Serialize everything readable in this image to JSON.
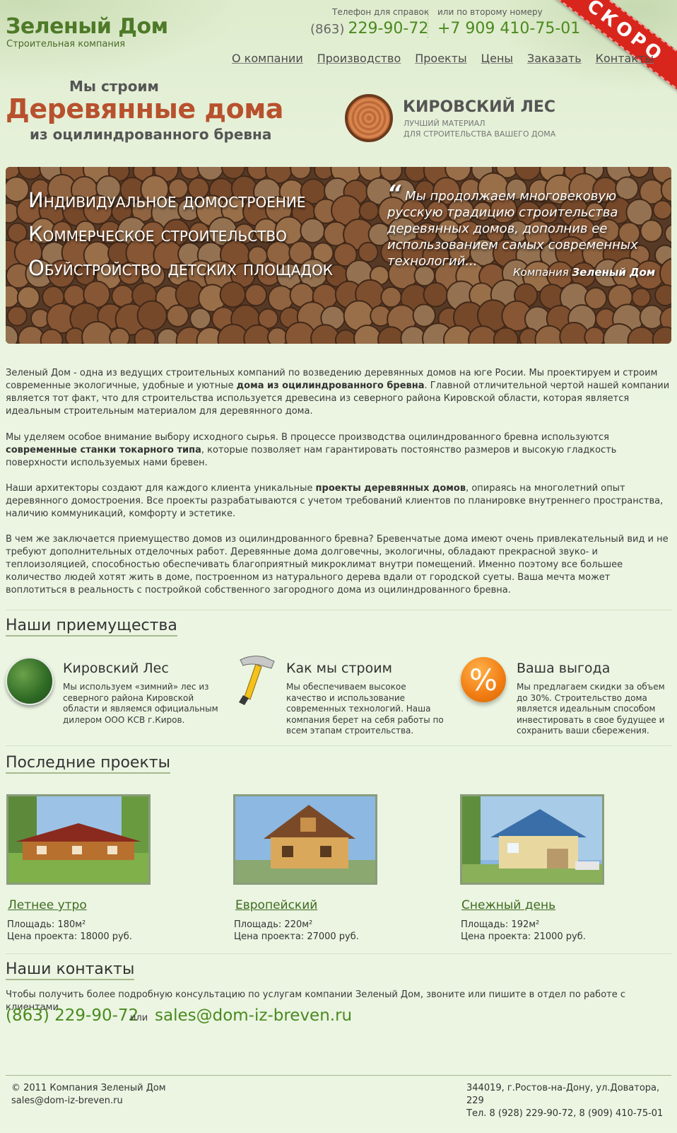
{
  "header": {
    "logo_title": "Зеленый Дом",
    "logo_subtitle": "Строительная компания",
    "phone1_label": "Телефон для справок",
    "phone1_code": "(863)",
    "phone1_number": "229-90-72",
    "phone2_label": "или по второму номеру",
    "phone2_number": "+7 909 410-75-01",
    "ribbon": "СКОРО",
    "nav": [
      "О компании",
      "Производство",
      "Проекты",
      "Цены",
      "Заказать",
      "Контакты"
    ]
  },
  "headline": {
    "small": "Мы строим",
    "big": "Деревянные дома",
    "sub": "из оцилиндрованного бревна"
  },
  "partner": {
    "title": "КИРОВСКИЙ ЛЕС",
    "line1": "ЛУЧШИЙ МАТЕРИАЛ",
    "line2": "ДЛЯ СТРОИТЕЛЬСТВА ВАШЕГО ДОМА"
  },
  "banner": {
    "lines": [
      "Индивидуальное домостроение",
      "Коммерческое строительство",
      "Обуйстройство детских площадок"
    ],
    "quote_mark": "“",
    "quote": "Мы продолжаем многовековую русскую традицию строительства деревянных домов, дополнив ее использованием самых современных технологий...",
    "author_prefix": "Компания",
    "author_name": "Зеленый Дом"
  },
  "intro": {
    "p1a": "Зеленый Дом - одна из ведущих строительных компаний по возведению деревянных домов на юге Росии. Мы проектируем и строим современные экологичные, удобные и уютные ",
    "p1b": "дома из оцилиндрованного бревна",
    "p1c": ". Главной отличительной чертой нашей компании является тот факт, что для строительства используется древесина из северного района Кировской области, которая является идеальным строительным материалом для деревянного дома.",
    "p2a": "Мы уделяем особое внимание выбору исходного сырья. В процессе производства оцилиндрованного бревна используются ",
    "p2b": "современные станки токарного типа",
    "p2c": ", которые позволяет нам гарантировать постоянство размеров и высокую гладкость поверхности используемых нами бревен.",
    "p3a": "Наши архитекторы создают для каждого клиента уникальные ",
    "p3b": "проекты деревянных домов",
    "p3c": ", опираясь на многолетний опыт деревянного домостроения. Все проекты разрабатываются с учетом требований клиентов по планировке внутреннего пространства, наличию коммуникаций, комфорту и эстетике.",
    "p4": "В чем же заключается приемущество домов из оцилиндрованного бревна? Бревенчатые дома имеют очень привлекательный вид и не требуют дополнительных отделочных работ. Деревянные дома долговечны, экологичны, обладают прекрасной звуко- и теплоизоляцией, способностью обеспечивать благоприятный микроклимат внутри помещений. Именно поэтому все большее количество людей хотят жить в доме, построенном из натурального дерева вдали от городской суеты. Ваша мечта может воплотиться в реальность с постройкой собственного загородного дома из оцилиндрованного бревна."
  },
  "advantages": {
    "title": "Наши приемущества",
    "items": [
      {
        "title": "Кировский Лес",
        "text": "Мы используем «зимний» лес из северного района Кировской области и являемся официальным дилером ООО КСВ г.Киров."
      },
      {
        "title": "Как мы строим",
        "text": "Мы обеспечиваем высокое качество и использование современных технологий. Наша компания берет на себя работы по всем этапам строительства."
      },
      {
        "title": "Ваша выгода",
        "text": "Мы предлагаем скидки за объем до 30%. Строительство дома является идеальным способом инвестировать в свое будущее и сохранить ваши сбережения."
      }
    ],
    "percent_symbol": "%"
  },
  "projects": {
    "title": "Последние проекты",
    "area_label": "Площадь:",
    "price_label": "Цена проекта:",
    "items": [
      {
        "name": "Летнее утро",
        "area": "180м²",
        "price": "18000 руб."
      },
      {
        "name": "Европейский",
        "area": "220м²",
        "price": "27000 руб."
      },
      {
        "name": "Снежный день",
        "area": "192м²",
        "price": "21000 руб."
      }
    ]
  },
  "contacts": {
    "title": "Наши контакты",
    "text": "Чтобы получить более подробную консультацию по услугам компании Зеленый Дом, звоните или пишите в отдел по работе с клиентами.",
    "phone": "(863) 229-90-72",
    "or": "или",
    "email": "sales@dom-iz-breven.ru"
  },
  "footer": {
    "copyright": "© 2011 Компания Зеленый Дом",
    "email": "sales@dom-iz-breven.ru",
    "address": "344019, г.Ростов-на-Дону, ул.Доватора, 229",
    "phones": "Тел. 8 (928) 229-90-72, 8 (909) 410-75-01"
  },
  "colors": {
    "brand_green": "#4e7a28",
    "accent_wood": "#b8512e",
    "ribbon_red": "#d8261c",
    "background": "#ebf5e2"
  }
}
